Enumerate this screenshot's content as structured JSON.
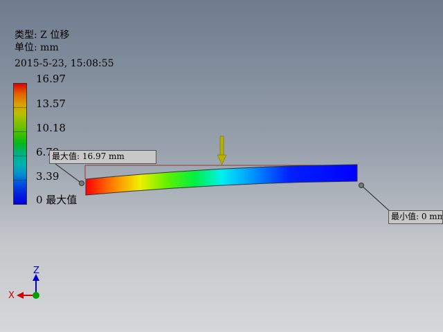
{
  "legend": {
    "type_line": "类型: Z 位移",
    "unit_line": "单位: mm",
    "timestamp": "2015-5-23, 15:08:55",
    "ticks": [
      "16.97",
      "13.57",
      "10.18",
      "6.79",
      "3.39",
      "0 最大值"
    ]
  },
  "callouts": {
    "max_label": "最大值: 16.97 mm",
    "min_label": "最小值: 0 mm"
  },
  "triad": {
    "x_label": "X",
    "z_label": "Z"
  },
  "colors": {
    "load_arrow": "#b8b000",
    "x_axis": "#d00000",
    "z_axis": "#0000d0",
    "origin": "#00a000"
  }
}
